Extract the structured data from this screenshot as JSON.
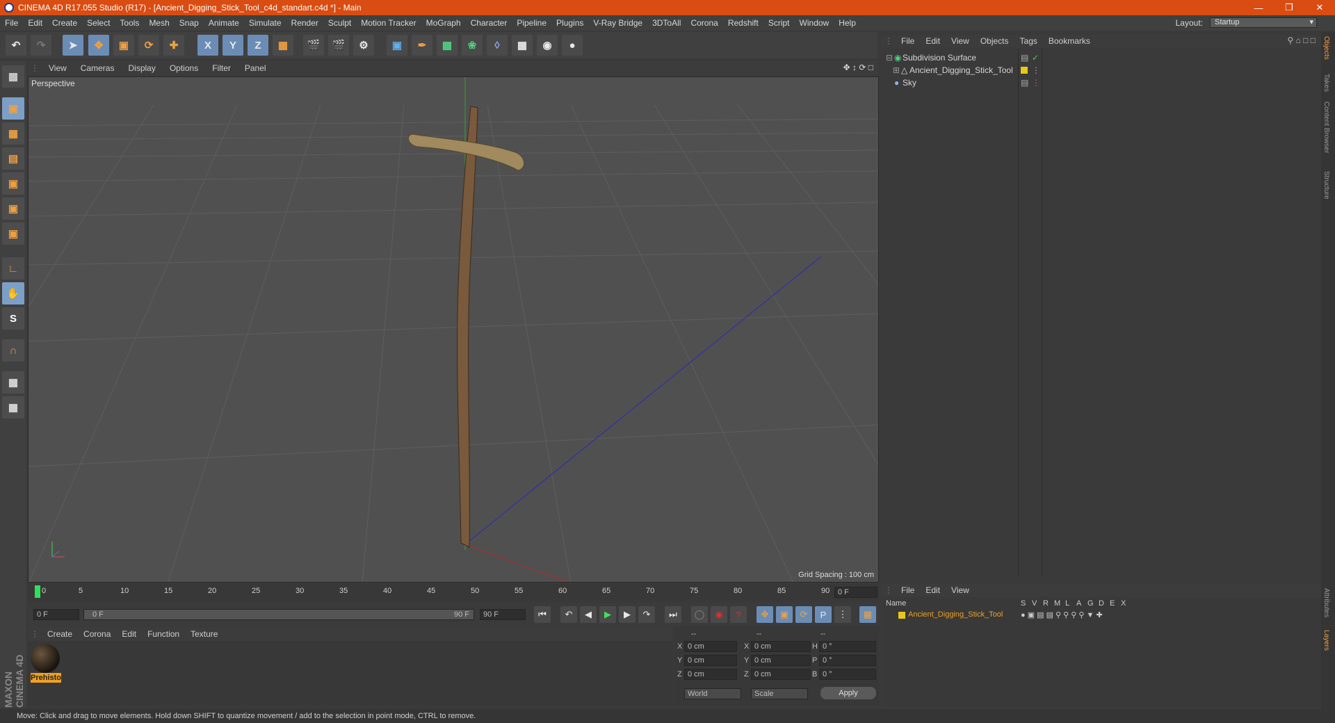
{
  "title_bar": {
    "text": "CINEMA 4D R17.055 Studio (R17) - [Ancient_Digging_Stick_Tool_c4d_standart.c4d *] - Main"
  },
  "menu_bar": {
    "items": [
      "File",
      "Edit",
      "Create",
      "Select",
      "Tools",
      "Mesh",
      "Snap",
      "Animate",
      "Simulate",
      "Render",
      "Sculpt",
      "Motion Tracker",
      "MoGraph",
      "Character",
      "Pipeline",
      "Plugins",
      "V-Ray Bridge",
      "3DToAll",
      "Corona",
      "Redshift",
      "Script",
      "Window",
      "Help"
    ],
    "layout_label": "Layout:",
    "layout_value": "Startup"
  },
  "viewport": {
    "menu": [
      "View",
      "Cameras",
      "Display",
      "Options",
      "Filter",
      "Panel"
    ],
    "label": "Perspective",
    "grid_spacing": "Grid Spacing : 100 cm"
  },
  "timeline": {
    "ticks": [
      "0",
      "5",
      "10",
      "15",
      "20",
      "25",
      "30",
      "35",
      "40",
      "45",
      "50",
      "55",
      "60",
      "65",
      "70",
      "75",
      "80",
      "85",
      "90"
    ],
    "current_frame": "0 F"
  },
  "transport": {
    "start": "0 F",
    "range_start": "0 F",
    "range_end": "90 F",
    "end": "90 F"
  },
  "material_manager": {
    "menu": [
      "Create",
      "Corona",
      "Edit",
      "Function",
      "Texture"
    ],
    "materials": [
      {
        "name": "Prehisto"
      }
    ]
  },
  "coordinates": {
    "headers": [
      "--",
      "--",
      "--"
    ],
    "rows": [
      {
        "a": "X",
        "a_val": "0 cm",
        "b": "X",
        "b_val": "0 cm",
        "c": "H",
        "c_val": "0 °"
      },
      {
        "a": "Y",
        "a_val": "0 cm",
        "b": "Y",
        "b_val": "0 cm",
        "c": "P",
        "c_val": "0 °"
      },
      {
        "a": "Z",
        "a_val": "0 cm",
        "b": "Z",
        "b_val": "0 cm",
        "c": "B",
        "c_val": "0 °"
      }
    ],
    "mode": "World",
    "scale": "Scale",
    "apply": "Apply"
  },
  "object_manager": {
    "menu": [
      "File",
      "Edit",
      "View",
      "Objects",
      "Tags",
      "Bookmarks"
    ],
    "objects": [
      {
        "name": "Subdivision Surface"
      },
      {
        "name": "Ancient_Digging_Stick_Tool"
      },
      {
        "name": "Sky"
      }
    ]
  },
  "layer_manager": {
    "menu": [
      "File",
      "Edit",
      "View"
    ],
    "columns": [
      "Name",
      "S",
      "V",
      "R",
      "M",
      "L",
      "A",
      "G",
      "D",
      "E",
      "X"
    ],
    "layers": [
      {
        "name": "Ancient_Digging_Stick_Tool"
      }
    ]
  },
  "side_tabs": [
    "Objects",
    "Takes",
    "Content Browser",
    "Structure",
    "Attributes",
    "Layers"
  ],
  "status": {
    "text": "Move: Click and drag to move elements. Hold down SHIFT to quantize movement / add to the selection in point mode, CTRL to remove."
  },
  "colors": {
    "title_bar": "#d94c12",
    "layer_yellow": "#e8c81a",
    "accent_blue": "#6b8db5"
  }
}
